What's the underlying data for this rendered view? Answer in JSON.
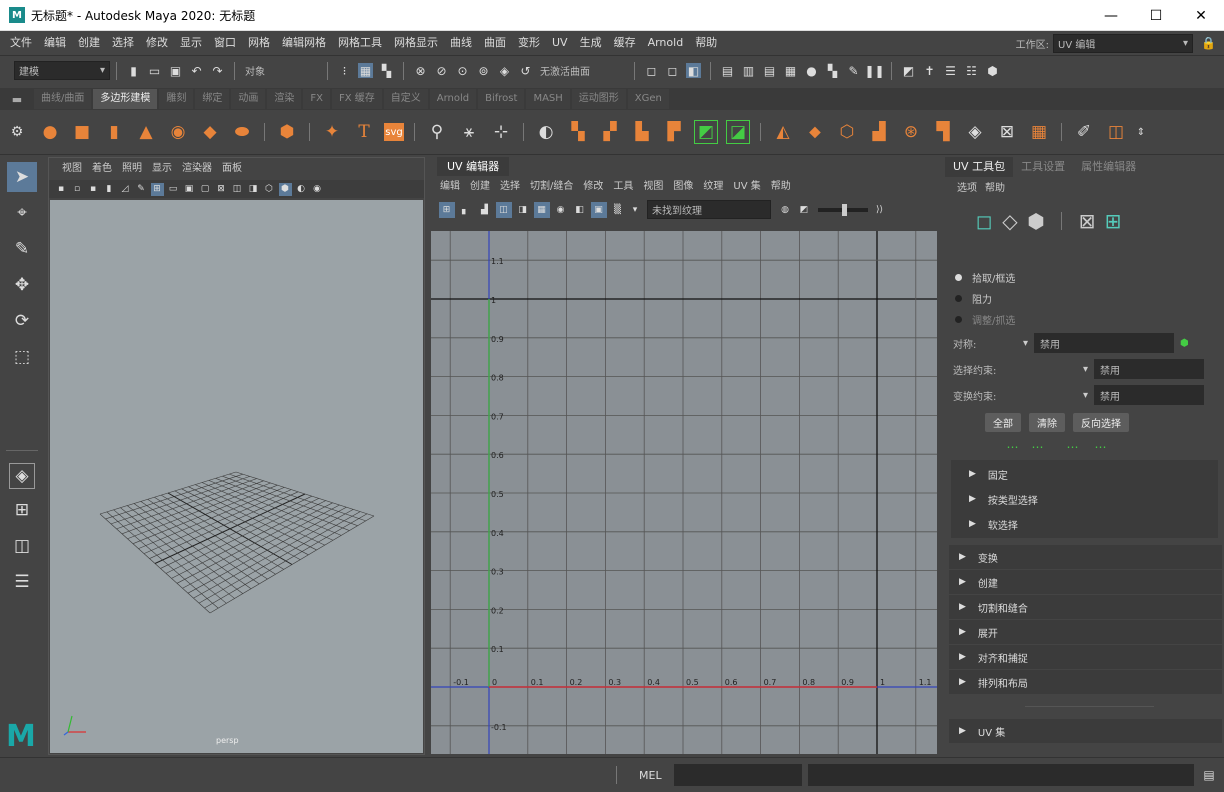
{
  "window": {
    "title": "无标题* - Autodesk Maya 2020: 无标题",
    "app_icon": "M",
    "min": "—",
    "max": "☐",
    "close": "✕"
  },
  "menu": [
    "文件",
    "编辑",
    "创建",
    "选择",
    "修改",
    "显示",
    "窗口",
    "网格",
    "编辑网格",
    "网格工具",
    "网格显示",
    "曲线",
    "曲面",
    "变形",
    "UV",
    "生成",
    "缓存",
    "Arnold",
    "帮助"
  ],
  "workspace": {
    "label": "工作区:",
    "value": "UV 编辑"
  },
  "statusline": {
    "mode": "建模",
    "object_field": "对象",
    "no_live_surface": "无激活曲面"
  },
  "shelf_tabs": [
    "曲线/曲面",
    "多边形建模",
    "雕刻",
    "绑定",
    "动画",
    "渲染",
    "FX",
    "FX 缓存",
    "自定义",
    "Arnold",
    "Bifrost",
    "MASH",
    "运动图形",
    "XGen"
  ],
  "shelf_active_tab": "多边形建模",
  "viewport": {
    "menu": [
      "视图",
      "着色",
      "照明",
      "显示",
      "渲染器",
      "面板"
    ],
    "camera_label": "persp"
  },
  "uv_editor": {
    "tab": "UV 编辑器",
    "menu": [
      "编辑",
      "创建",
      "选择",
      "切割/缝合",
      "修改",
      "工具",
      "视图",
      "图像",
      "纹理",
      "UV 集",
      "帮助"
    ],
    "texture_field": "未找到纹理",
    "v_labels": [
      "1.1",
      "1",
      "0.9",
      "0.8",
      "0.7",
      "0.6",
      "0.5",
      "0.4",
      "0.3",
      "0.2",
      "0.1",
      "0",
      "-0.1"
    ],
    "u_labels": [
      "-0.1",
      "0",
      "0.1",
      "0.2",
      "0.3",
      "0.4",
      "0.5",
      "0.6",
      "0.7",
      "0.8",
      "0.9",
      "1",
      "1.1"
    ]
  },
  "right_panel": {
    "tabs": [
      "UV 工具包",
      "工具设置",
      "属性编辑器"
    ],
    "menu": [
      "选项",
      "帮助"
    ],
    "radio_items": [
      "拾取/框选",
      "阻力",
      "调整/抓选"
    ],
    "symmetry": {
      "label": "对称:",
      "value": "禁用"
    },
    "select_constraint": {
      "label": "选择约束:",
      "value": "禁用"
    },
    "transform_constraint": {
      "label": "变换约束:",
      "value": "禁用"
    },
    "buttons": [
      "全部",
      "清除",
      "反向选择"
    ],
    "subsections": [
      "固定",
      "按类型选择",
      "软选择"
    ],
    "sections": [
      "变换",
      "创建",
      "切割和缝合",
      "展开",
      "对齐和捕捉",
      "排列和布局"
    ],
    "uv_sets": "UV 集"
  },
  "command_line": {
    "label": "MEL"
  }
}
